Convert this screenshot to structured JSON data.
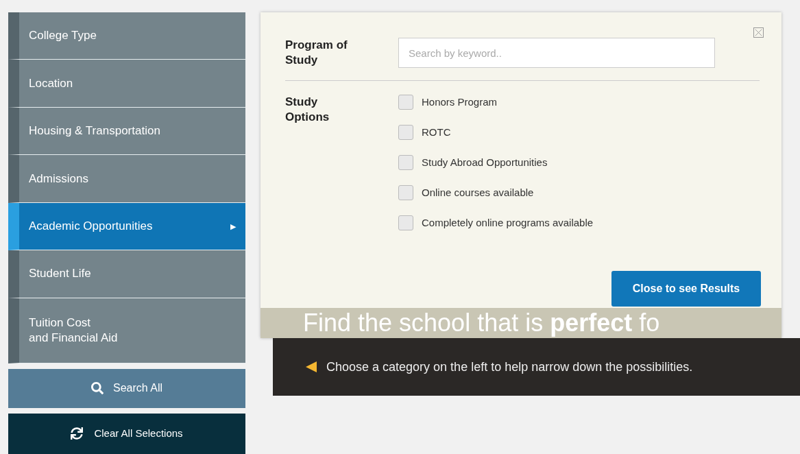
{
  "sidebar": {
    "items": [
      {
        "label": "College Type",
        "selected": false
      },
      {
        "label": "Location",
        "selected": false
      },
      {
        "label": "Housing & Transportation",
        "selected": false
      },
      {
        "label": "Admissions",
        "selected": false
      },
      {
        "label": "Academic Opportunities",
        "selected": true,
        "arrow": "▶"
      },
      {
        "label": "Student Life",
        "selected": false
      },
      {
        "label": "Tuition Cost\nand Financial Aid",
        "selected": false
      }
    ],
    "search_button": "Search All",
    "clear_button": "Clear All Selections"
  },
  "panel": {
    "program_label": "Program of\nStudy",
    "search": {
      "placeholder": "Search by keyword.."
    },
    "options_label": "Study\nOptions",
    "options": [
      {
        "label": "Honors Program",
        "checked": false
      },
      {
        "label": "ROTC",
        "checked": false
      },
      {
        "label": "Study Abroad Opportunities",
        "checked": false
      },
      {
        "label": "Online courses available",
        "checked": false
      },
      {
        "label": "Completely online programs available",
        "checked": false
      }
    ],
    "close_button": "Close to see Results"
  },
  "hero": {
    "headline": "Find the school that is **perfect** fo",
    "hint": "Choose a category on the left to help narrow down the possibilities."
  }
}
